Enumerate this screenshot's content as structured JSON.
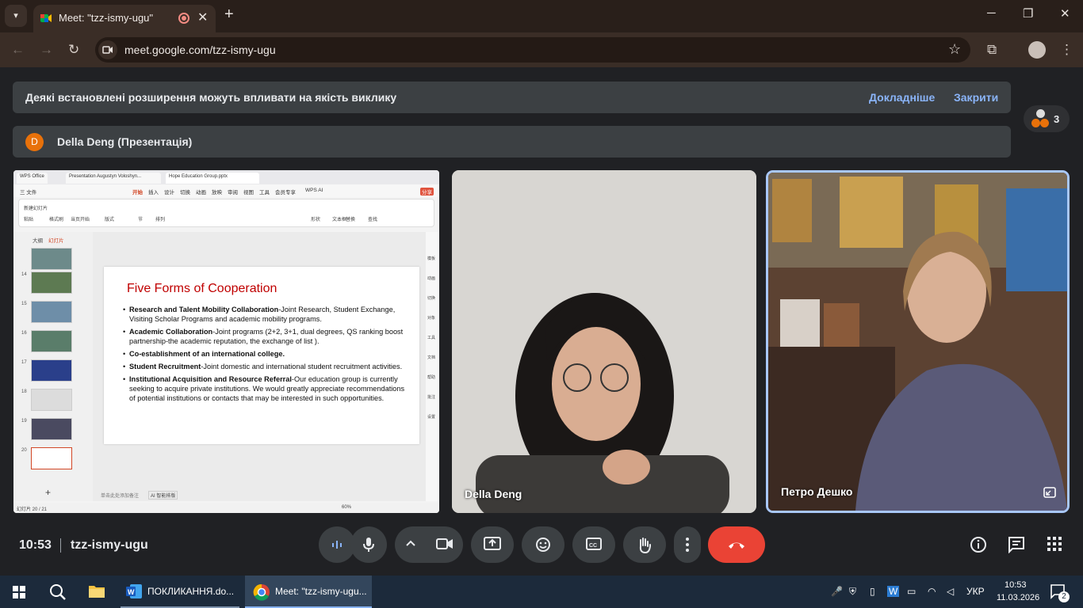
{
  "browser": {
    "tab_title": "Meet: \"tzz-ismy-ugu\"",
    "url": "meet.google.com/tzz-ismy-ugu",
    "new_tab": "+",
    "tab_close": "✕",
    "minimize": "─",
    "maximize": "❐",
    "close": "✕"
  },
  "banner": {
    "message": "Деякі встановлені розширення можуть впливати на якість виклику",
    "learn_more": "Докладніше",
    "close": "Закрити"
  },
  "presentation": {
    "avatar_letter": "D",
    "title": "Della Deng (Презентація)"
  },
  "participants_count": "3",
  "wps": {
    "tabs": [
      "WPS Office",
      "Presentation Augustyn Voloshyn...",
      "Hope Education Group.pptx"
    ],
    "menu": [
      "三 文件",
      "开始",
      "插入",
      "设计",
      "切换",
      "动画",
      "放映",
      "审阅",
      "视图",
      "工具",
      "会员专享",
      "WPS AI",
      "分享"
    ],
    "ribbon": [
      "新建幻灯片",
      "当页开始",
      "版式",
      "节",
      "排列",
      "替换",
      "查找",
      "粘贴",
      "格式刷",
      "形状",
      "文本框"
    ],
    "panel_tabs": [
      "大纲",
      "幻灯片"
    ],
    "slide_numbers": [
      "14",
      "15",
      "16",
      "17",
      "18",
      "19",
      "20"
    ],
    "slide": {
      "title": "Five Forms of Cooperation",
      "bullets": [
        {
          "bold": "Research and Talent Mobility Collaboration",
          "text": "-Joint Research, Student Exchange, Visiting Scholar Programs and academic mobility programs."
        },
        {
          "bold": "Academic Collaboration",
          "text": "-Joint programs (2+2, 3+1, dual degrees, QS ranking boost partnership-the academic reputation, the exchange of list )."
        },
        {
          "bold": "Co-establishment of an international college.",
          "text": ""
        },
        {
          "bold": "Student Recruitment",
          "text": "-Joint domestic and international student recruitment activities."
        },
        {
          "bold": "Institutional Acquisition and Resource Referral",
          "text": "-Our education group is currently seeking to acquire private institutions. We would greatly appreciate recommendations of potential institutions or contacts that may be interested in such opportunities."
        }
      ]
    },
    "right_tools": [
      "模板",
      "动画",
      "切换",
      "对象",
      "工具",
      "文档",
      "帮助",
      "批注",
      "设置"
    ],
    "note_hint": "单击此处添加备注",
    "ai_label": "AI 智能排版",
    "status_slide": "幻灯片 20 / 21",
    "status_zoom": "60%"
  },
  "tiles": {
    "della_name": "Della Deng",
    "petro_name": "Петро Дешко"
  },
  "controls": {
    "time": "10:53",
    "meeting_code": "tzz-ismy-ugu"
  },
  "taskbar": {
    "word_label": "ПОКЛИКАННЯ.do...",
    "chrome_label": "Meet: \"tzz-ismy-ugu...",
    "lang": "УКР",
    "time": "10:53",
    "date": "11.03.2026",
    "notifications": "2"
  }
}
